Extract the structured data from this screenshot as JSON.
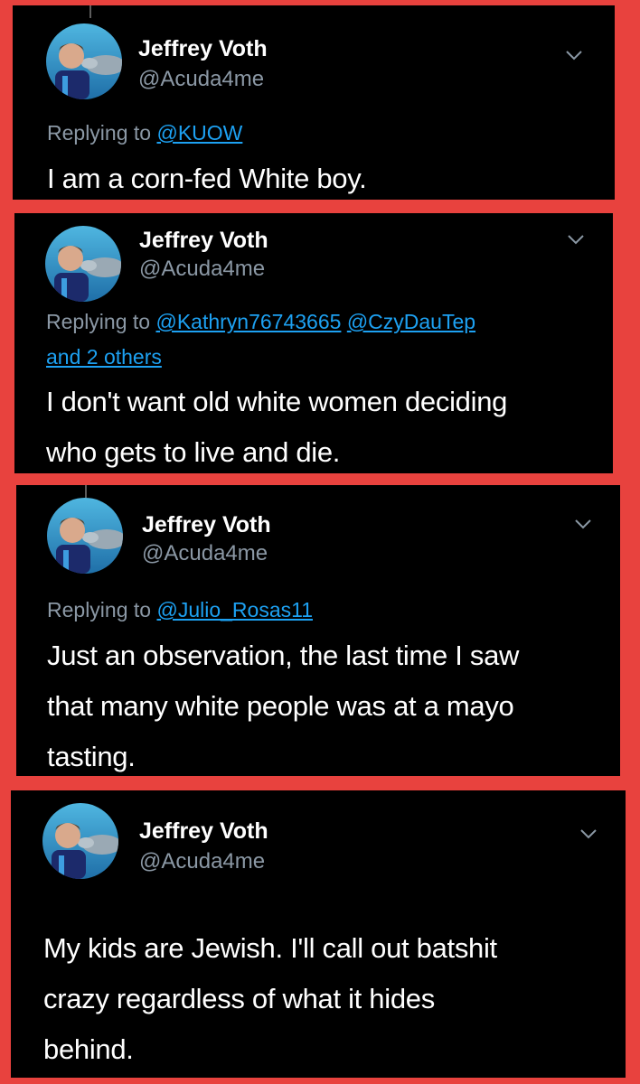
{
  "colors": {
    "frame_red": "#e8423e",
    "card_bg": "#000000",
    "name": "#ffffff",
    "secondary": "#8b98a5",
    "link": "#1da1f2"
  },
  "icons": {
    "more": "chevron-down-icon",
    "avatar": "profile-photo-with-dolphin"
  },
  "tweets": [
    {
      "name": "Jeffrey Voth",
      "handle": "@Acuda4me",
      "replying_prefix": "Replying to",
      "mentions": [
        "@KUOW"
      ],
      "mentions_line2": "",
      "text_lines": [
        "I am a corn-fed White boy."
      ]
    },
    {
      "name": "Jeffrey Voth",
      "handle": "@Acuda4me",
      "replying_prefix": "Replying to",
      "mentions": [
        "@Kathryn76743665",
        "@CzyDauTep"
      ],
      "mentions_line2": "and 2 others",
      "text_lines": [
        "I don't want old white women deciding",
        "who gets to live and die."
      ]
    },
    {
      "name": "Jeffrey Voth",
      "handle": "@Acuda4me",
      "replying_prefix": "Replying to",
      "mentions": [
        "@Julio_Rosas11"
      ],
      "mentions_line2": "",
      "text_lines": [
        "Just an observation, the last time I saw",
        "that many white people was at a mayo",
        "tasting."
      ]
    },
    {
      "name": "Jeffrey Voth",
      "handle": "@Acuda4me",
      "replying_prefix": "",
      "mentions": [],
      "mentions_line2": "",
      "text_lines": [
        "My kids are Jewish. I'll call out batshit",
        "crazy regardless of what it hides",
        "behind."
      ]
    }
  ]
}
